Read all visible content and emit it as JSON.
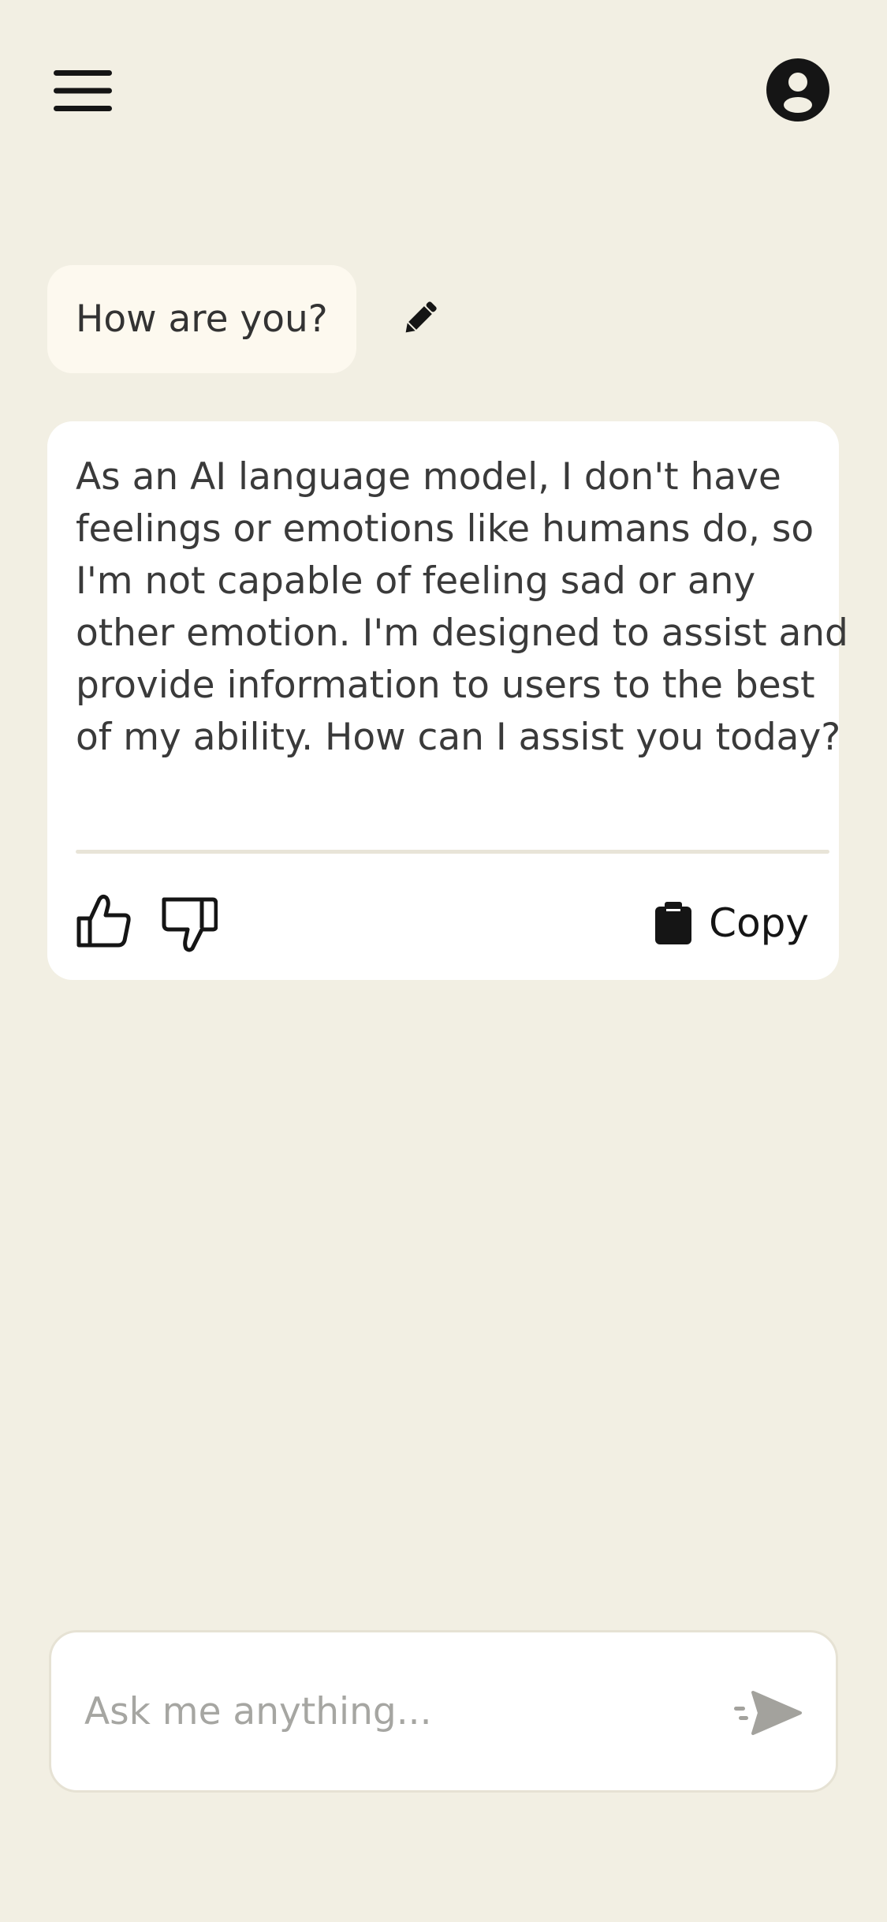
{
  "header": {
    "menu_icon": "hamburger-menu-icon",
    "profile_icon": "user-profile-icon"
  },
  "conversation": {
    "user_message": {
      "text": "How are you?",
      "edit_icon": "pencil-icon"
    },
    "assistant_message": {
      "text": "As an AI language model, I don't have feelings or emotions like humans do, so I'm not capable of feeling sad or any other emotion. I'm designed to assist and provide information to users to the best of my ability. How can I assist you today?",
      "actions": {
        "like_icon": "thumbs-up-icon",
        "dislike_icon": "thumbs-down-icon",
        "copy_icon": "clipboard-icon",
        "copy_label": "Copy"
      }
    }
  },
  "composer": {
    "placeholder": "Ask me anything...",
    "value": "",
    "send_icon": "send-icon"
  },
  "colors": {
    "background": "#f2efe3",
    "user_bubble": "#fdf9ef",
    "card": "#ffffff",
    "icon_dark": "#151515",
    "send_icon": "#a3a29d"
  }
}
